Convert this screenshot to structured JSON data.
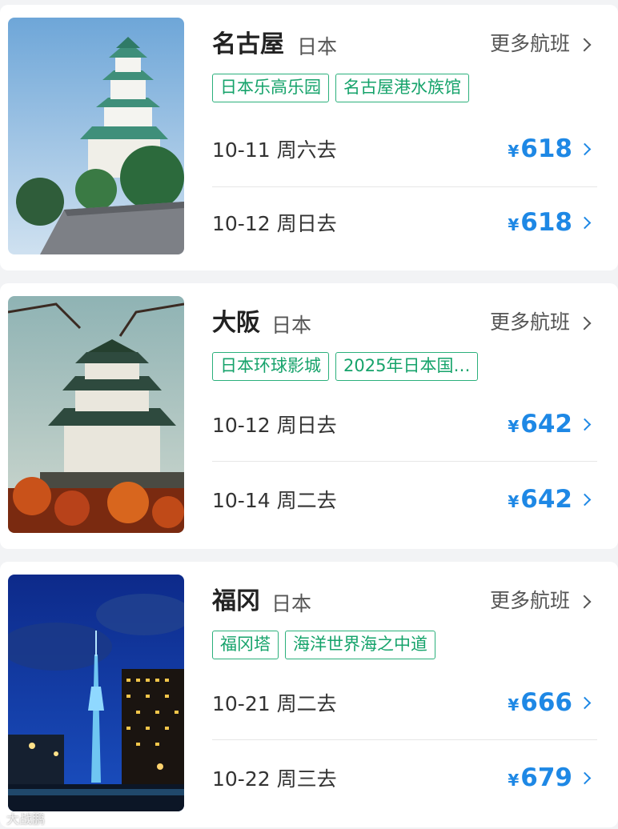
{
  "destinations": [
    {
      "city": "名古屋",
      "country": "日本",
      "more_label": "更多航班",
      "tags": [
        "日本乐高乐园",
        "名古屋港水族馆"
      ],
      "flights": [
        {
          "date": "10-11 周六去",
          "currency": "¥",
          "price": "618"
        },
        {
          "date": "10-12 周日去",
          "currency": "¥",
          "price": "618"
        }
      ]
    },
    {
      "city": "大阪",
      "country": "日本",
      "more_label": "更多航班",
      "tags": [
        "日本环球影城",
        "2025年日本国…"
      ],
      "flights": [
        {
          "date": "10-12 周日去",
          "currency": "¥",
          "price": "642"
        },
        {
          "date": "10-14 周二去",
          "currency": "¥",
          "price": "642"
        }
      ]
    },
    {
      "city": "福冈",
      "country": "日本",
      "more_label": "更多航班",
      "tags": [
        "福冈塔",
        "海洋世界海之中道"
      ],
      "flights": [
        {
          "date": "10-21 周二去",
          "currency": "¥",
          "price": "666"
        },
        {
          "date": "10-22 周三去",
          "currency": "¥",
          "price": "679"
        }
      ]
    }
  ],
  "watermark": "大战鹏",
  "colors": {
    "accent_blue": "#1e88e5",
    "tag_green": "#16a36b",
    "background": "#f2f3f5"
  },
  "icons": {
    "more": "chevron-right-icon",
    "price": "chevron-right-icon"
  }
}
